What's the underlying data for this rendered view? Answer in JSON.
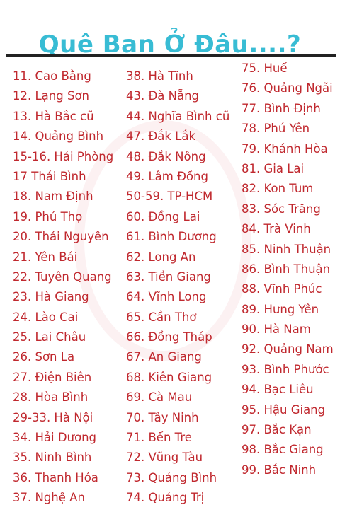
{
  "title": "Quê Bạn Ở Đâu....?",
  "columns": [
    {
      "items": [
        "11. Cao Bằng",
        "12. Lạng Sơn",
        "13. Hà Bắc cũ",
        "14. Quảng Bình",
        "15-16. Hải Phòng",
        "17 Thái Bình",
        "18. Nam Định",
        "19. Phú Thọ",
        "20. Thái Nguyên",
        "21. Yên Bái",
        "22. Tuyên Quang",
        "23. Hà Giang",
        "24. Lào Cai",
        "25. Lai Châu",
        "26. Sơn La",
        "27. Điện Biên",
        "28. Hòa Bình",
        "29-33. Hà Nội",
        "34. Hải Dương",
        "35. Ninh Bình",
        "36. Thanh Hóa",
        "37. Nghệ An"
      ]
    },
    {
      "items": [
        "38. Hà Tĩnh",
        "43. Đà Nẵng",
        "44. Nghĩa Bình cũ",
        "47. Đắk Lắk",
        "48. Đắk Nông",
        "49. Lâm Đồng",
        "50-59. TP-HCM",
        "60. Đồng Lai",
        "61. Bình Dương",
        "62. Long An",
        "63. Tiền Giang",
        "64. Vĩnh Long",
        "65. Cần Thơ",
        "66. Đồng Tháp",
        "67. An Giang",
        "68. Kiên Giang",
        "69. Cà Mau",
        "70. Tây Ninh",
        "71. Bến Tre",
        "72. Vũng Tàu",
        "73. Quảng Bình",
        "74. Quảng Trị"
      ]
    },
    {
      "items": [
        "75. Huế",
        "76. Quảng Ngãi",
        "77. Bình Định",
        "78. Phú Yên",
        "79. Khánh Hòa",
        "81. Gia Lai",
        "82. Kon Tum",
        "83. Sóc Trăng",
        "84. Trà Vinh",
        "85. Ninh Thuận",
        "86. Bình Thuận",
        "88. Vĩnh Phúc",
        "89. Hưng Yên",
        "90. Hà Nam",
        "92. Quảng Nam",
        "93. Bình Phước",
        "94. Bạc Liêu",
        "95. Hậu Giang",
        "97. Bắc Kạn",
        "98. Bắc Giang",
        "99. Bắc Ninh"
      ]
    }
  ],
  "colors": {
    "title": "#38bcd4",
    "text": "#c0282e",
    "divider": "#222222"
  }
}
